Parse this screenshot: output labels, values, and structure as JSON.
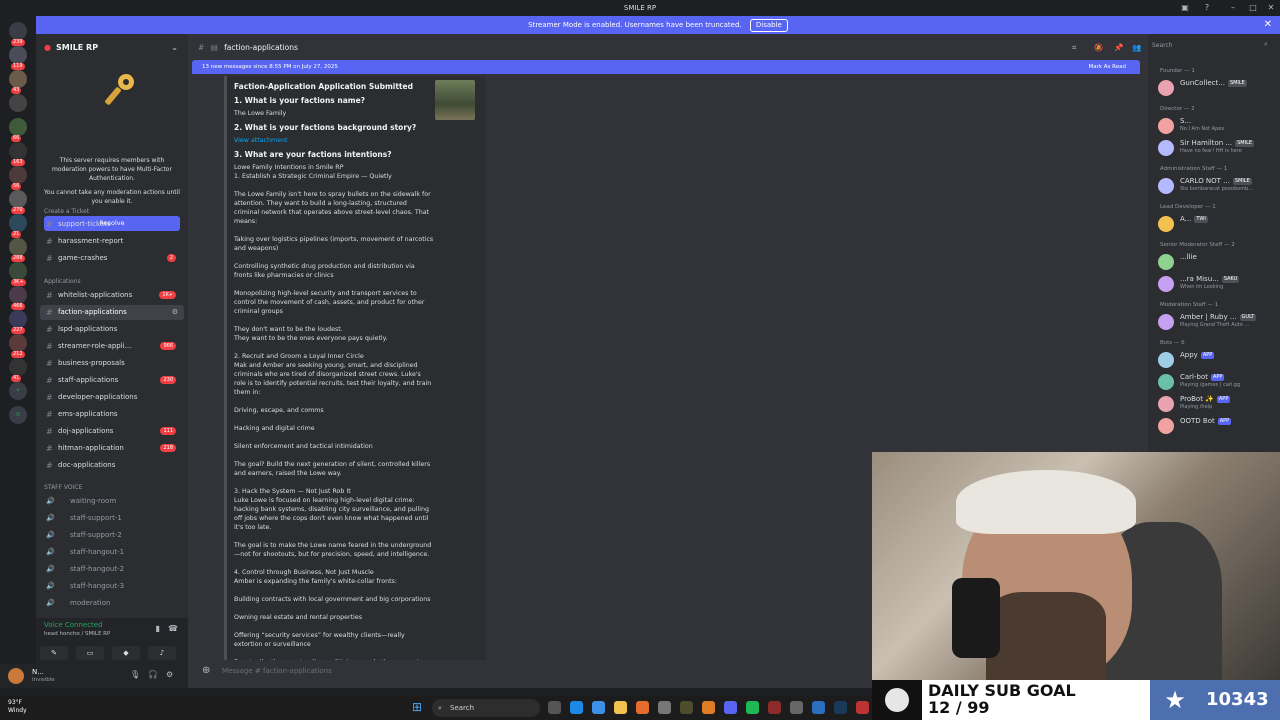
{
  "window": {
    "title": "SMILE RP"
  },
  "streamer_banner": {
    "text": "Streamer Mode is enabled. Usernames have been truncated.",
    "button": "Disable"
  },
  "rail": {
    "servers": [
      {
        "badge": "239"
      },
      {
        "badge": "119"
      },
      {
        "badge": "43"
      },
      {
        "badge": ""
      },
      {
        "badge": "66"
      },
      {
        "badge": "163"
      },
      {
        "badge": "56"
      },
      {
        "badge": "270"
      },
      {
        "badge": "21"
      },
      {
        "badge": "288"
      },
      {
        "badge": "3K+"
      },
      {
        "badge": "466"
      },
      {
        "badge": "227"
      },
      {
        "badge": "212"
      },
      {
        "badge": "41"
      }
    ]
  },
  "sidebar": {
    "server_name": "SMILE RP",
    "mfa": {
      "text": "This server requires members with moderation powers to have Multi-Factor Authentication.",
      "text2": "You cannot take any moderation actions until you enable it.",
      "button": "Resolve"
    },
    "cat_ticket": "Create a Ticket",
    "ticket_channels": [
      {
        "name": "support-tickets",
        "count": ""
      },
      {
        "name": "harassment-report",
        "count": ""
      },
      {
        "name": "game-crashes",
        "count": "2"
      }
    ],
    "cat_applications": "Applications",
    "application_channels": [
      {
        "name": "whitelist-applications",
        "count": "1K+"
      },
      {
        "name": "faction-applications",
        "count": ""
      },
      {
        "name": "lspd-applications",
        "count": ""
      },
      {
        "name": "streamer-role-appli...",
        "count": "966"
      },
      {
        "name": "business-proposals",
        "count": ""
      },
      {
        "name": "staff-applications",
        "count": "230"
      },
      {
        "name": "developer-applications",
        "count": ""
      },
      {
        "name": "ems-applications",
        "count": ""
      },
      {
        "name": "doj-applications",
        "count": "111"
      },
      {
        "name": "hitman-application",
        "count": "218"
      },
      {
        "name": "doc-applications",
        "count": ""
      }
    ],
    "cat_voice": "STAFF VOICE",
    "voice_channels": [
      "waiting-room",
      "staff-support-1",
      "staff-support-2",
      "staff-hangout-1",
      "staff-hangout-2",
      "staff-hangout-3",
      "moderation"
    ]
  },
  "voice": {
    "status": "Voice Connected",
    "sub": "head honcho / SMILE RP"
  },
  "user": {
    "name": "N...",
    "status": "Invisible"
  },
  "chat": {
    "channel": "faction-applications",
    "new_messages": "13 new messages since 8:55 PM on July 27, 2025",
    "mark_as_read": "Mark As Read",
    "composer_placeholder": "Message # faction-applications",
    "embed": {
      "title": "Faction-Application Application Submitted",
      "q1": "1. What is your factions name?",
      "a1": "The Lowe Family",
      "q2": "2. What is your factions background story?",
      "a2": "View attachment",
      "q3": "3. What are your factions intentions?",
      "paragraphs": [
        "Lowe Family Intentions in Smile RP",
        "1. Establish a Strategic Criminal Empire — Quietly",
        "The Lowe Family isn't here to spray bullets on the sidewalk for attention. They want to build a long-lasting, structured criminal network that operates above street-level chaos. That means:",
        "Taking over logistics pipelines (imports, movement of narcotics and weapons)",
        "Controlling synthetic drug production and distribution via fronts like pharmacies or clinics",
        "Monopolizing high-level security and transport services to control the movement of cash, assets, and product for other criminal groups",
        "They don't want to be the loudest.",
        "They want to be the ones everyone pays quietly.",
        "2. Recruit and Groom a Loyal Inner Circle",
        "Mak and Amber are seeking young, smart, and disciplined criminals who are tired of disorganized street crews. Luke's role is to identify potential recruits, test their loyalty, and train them in:",
        "Driving, escape, and comms",
        "Hacking and digital crime",
        "Silent enforcement and tactical intimidation",
        "The goal? Build the next generation of silent, controlled killers and earners, raised the Lowe way.",
        "3. Hack the System — Not Just Rob It",
        "Luke Lowe is focused on learning high-level digital crime: hacking bank systems, disabling city surveillance, and pulling off jobs where the cops don't even know what happened until it's too late.",
        "The goal is to make the Lowe name feared in the underground—not for shootouts, but for precision, speed, and intelligence.",
        "4. Control through Business, Not Just Muscle",
        "Amber is expanding the family's white-collar fronts:",
        "Building contracts with local government and big corporations",
        "Owning real estate and rental properties",
        "Offering “security services” for wealthy clients—really extortion or surveillance",
        "Eventually, they want police, politicians, and other gangs in their"
      ]
    }
  },
  "members": {
    "search_placeholder": "Search",
    "groups": [
      {
        "role": "Founder — 1",
        "members": [
          {
            "name": "GunCollect...",
            "tag": "SMILE",
            "status": ""
          }
        ]
      },
      {
        "role": "Director — 2",
        "members": [
          {
            "name": "S...",
            "tag": "",
            "status": "No I Am Not Apex"
          },
          {
            "name": "Sir Hamilton ...",
            "tag": "SMILE",
            "status": "Have no fear! HH is here"
          }
        ]
      },
      {
        "role": "Administration Staff — 1",
        "members": [
          {
            "name": "CARLO NOT ...",
            "tag": "SMILE",
            "status": "Ste bombaracat pooobomb..."
          }
        ]
      },
      {
        "role": "Lead Developer — 1",
        "members": [
          {
            "name": "A...",
            "tag": "TWI",
            "status": ""
          }
        ]
      },
      {
        "role": "Senior Moderator Staff — 2",
        "members": [
          {
            "name": "...llie",
            "tag": "",
            "status": ""
          },
          {
            "name": "...ra Misu...",
            "tag": "SAKU",
            "status": "When Im Looking"
          }
        ]
      },
      {
        "role": "Moderation Staff — 1",
        "members": [
          {
            "name": "Amber | Ruby ...",
            "tag": "GULT",
            "status": "Playing Grand Theft Auto ..."
          }
        ]
      },
      {
        "role": "Bots — 6",
        "members": [
          {
            "name": "Appy",
            "tag": "APP",
            "status": ""
          },
          {
            "name": "Carl-bot",
            "tag": "APP",
            "status": "Playing /games | carl.gg"
          },
          {
            "name": "ProBot ✨",
            "tag": "APP",
            "status": "Playing /help"
          },
          {
            "name": "OOTD Bot",
            "tag": "APP",
            "status": ""
          }
        ]
      }
    ]
  },
  "overlay": {
    "goal_label": "DAILY SUB GOAL",
    "goal_progress": "12 / 99",
    "count": "10343"
  },
  "taskbar": {
    "temp": "93°F",
    "weather": "Windy",
    "search": "Search"
  }
}
